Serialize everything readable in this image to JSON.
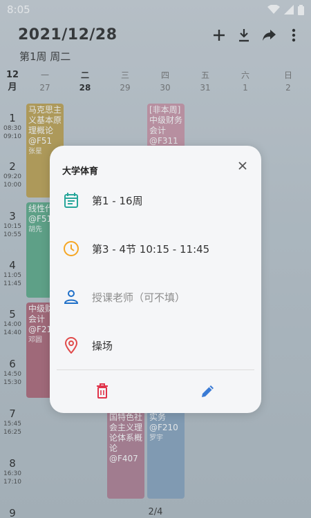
{
  "status_bar": {
    "time": "8:05"
  },
  "header": {
    "date": "2021/12/28",
    "week_info": "第1周  周二",
    "actions": [
      {
        "name": "add",
        "icon": "plus-icon"
      },
      {
        "name": "download",
        "icon": "download-icon"
      },
      {
        "name": "share",
        "icon": "share-icon"
      },
      {
        "name": "more",
        "icon": "more-vert-icon"
      }
    ]
  },
  "calendar": {
    "month_line1": "12",
    "month_line2": "月",
    "days": [
      {
        "weekday": "一",
        "date": "27",
        "today": false
      },
      {
        "weekday": "二",
        "date": "28",
        "today": true
      },
      {
        "weekday": "三",
        "date": "29",
        "today": false
      },
      {
        "weekday": "四",
        "date": "30",
        "today": false
      },
      {
        "weekday": "五",
        "date": "31",
        "today": false
      },
      {
        "weekday": "六",
        "date": "1",
        "today": false
      },
      {
        "weekday": "日",
        "date": "2",
        "today": false
      }
    ],
    "slots": [
      {
        "num": "1",
        "start": "08:30",
        "end": "09:10"
      },
      {
        "num": "2",
        "start": "09:20",
        "end": "10:00"
      },
      {
        "num": "3",
        "start": "10:15",
        "end": "10:55"
      },
      {
        "num": "4",
        "start": "11:05",
        "end": "11:45"
      },
      {
        "num": "5",
        "start": "14:00",
        "end": "14:40"
      },
      {
        "num": "6",
        "start": "14:50",
        "end": "15:30"
      },
      {
        "num": "7",
        "start": "15:45",
        "end": "16:25"
      },
      {
        "num": "8",
        "start": "16:30",
        "end": "17:10"
      },
      {
        "num": "9",
        "start": "",
        "end": ""
      }
    ],
    "courses": [
      {
        "title": "马克思主义基本原理概论",
        "room": "@F51",
        "teacher": "张星",
        "color": "#b99a43"
      },
      {
        "title": "[非本周]中级财务会计",
        "room": "@F311",
        "teacher": "",
        "color": "#c68da0"
      },
      {
        "title": "线性代数",
        "room": "@F51",
        "teacher": "胡先",
        "color": "#4fa37f"
      },
      {
        "title": "中级财务会计",
        "room": "@F21",
        "teacher": "邓圆",
        "color": "#a65a6d"
      },
      {
        "title": "思想和中国特色社会主义理论体系概论",
        "room": "@F407",
        "teacher": "",
        "color": "#a8738a"
      },
      {
        "title": "成本核算实务",
        "room": "@F210",
        "teacher": "罗宇",
        "color": "#7d9bb8"
      }
    ]
  },
  "page_indicator": "2/4",
  "dialog": {
    "title": "大学体育",
    "weeks": "第1 - 16周",
    "time": "第3 - 4节   10:15 - 11:45",
    "teacher_placeholder": "授课老师（可不填）",
    "location": "操场",
    "colors": {
      "weeks_icon": "#26a69a",
      "time_icon": "#f5a623",
      "teacher_icon": "#1e6fc8",
      "location_icon": "#e04a4a",
      "delete": "#e0334a",
      "edit": "#3a7bd5"
    }
  }
}
